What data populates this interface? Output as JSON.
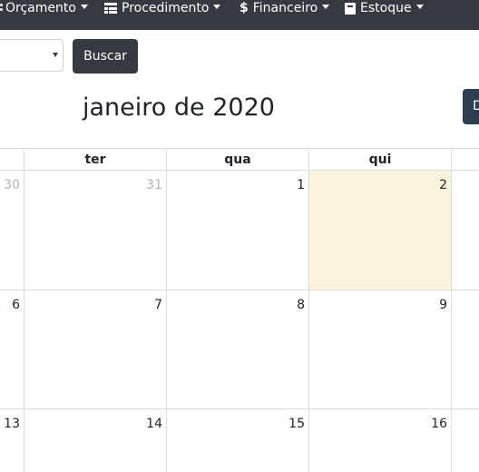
{
  "navbar": {
    "items": [
      {
        "label": "Orçamento",
        "icon": "ellipsis-vertical-icon"
      },
      {
        "label": "Procedimento",
        "icon": "table-icon"
      },
      {
        "label": "Financeiro",
        "icon": "dollar-icon"
      },
      {
        "label": "Estoque",
        "icon": "box-icon"
      }
    ]
  },
  "filter": {
    "select_value": "",
    "search_button": "Buscar"
  },
  "calendar": {
    "title": "janeiro de 2020",
    "view_button": "D",
    "weekdays": [
      "ter",
      "qua",
      "qui"
    ],
    "weeks": [
      [
        "30",
        "31",
        "1",
        "2"
      ],
      [
        "6",
        "7",
        "8",
        "9"
      ],
      [
        "13",
        "14",
        "15",
        "16"
      ]
    ],
    "today": "2",
    "colors": {
      "navbar": "#343a40",
      "today_highlight": "#fcf8e3",
      "grid": "#dddddd",
      "other_month_text": "#b5b5b5"
    }
  }
}
